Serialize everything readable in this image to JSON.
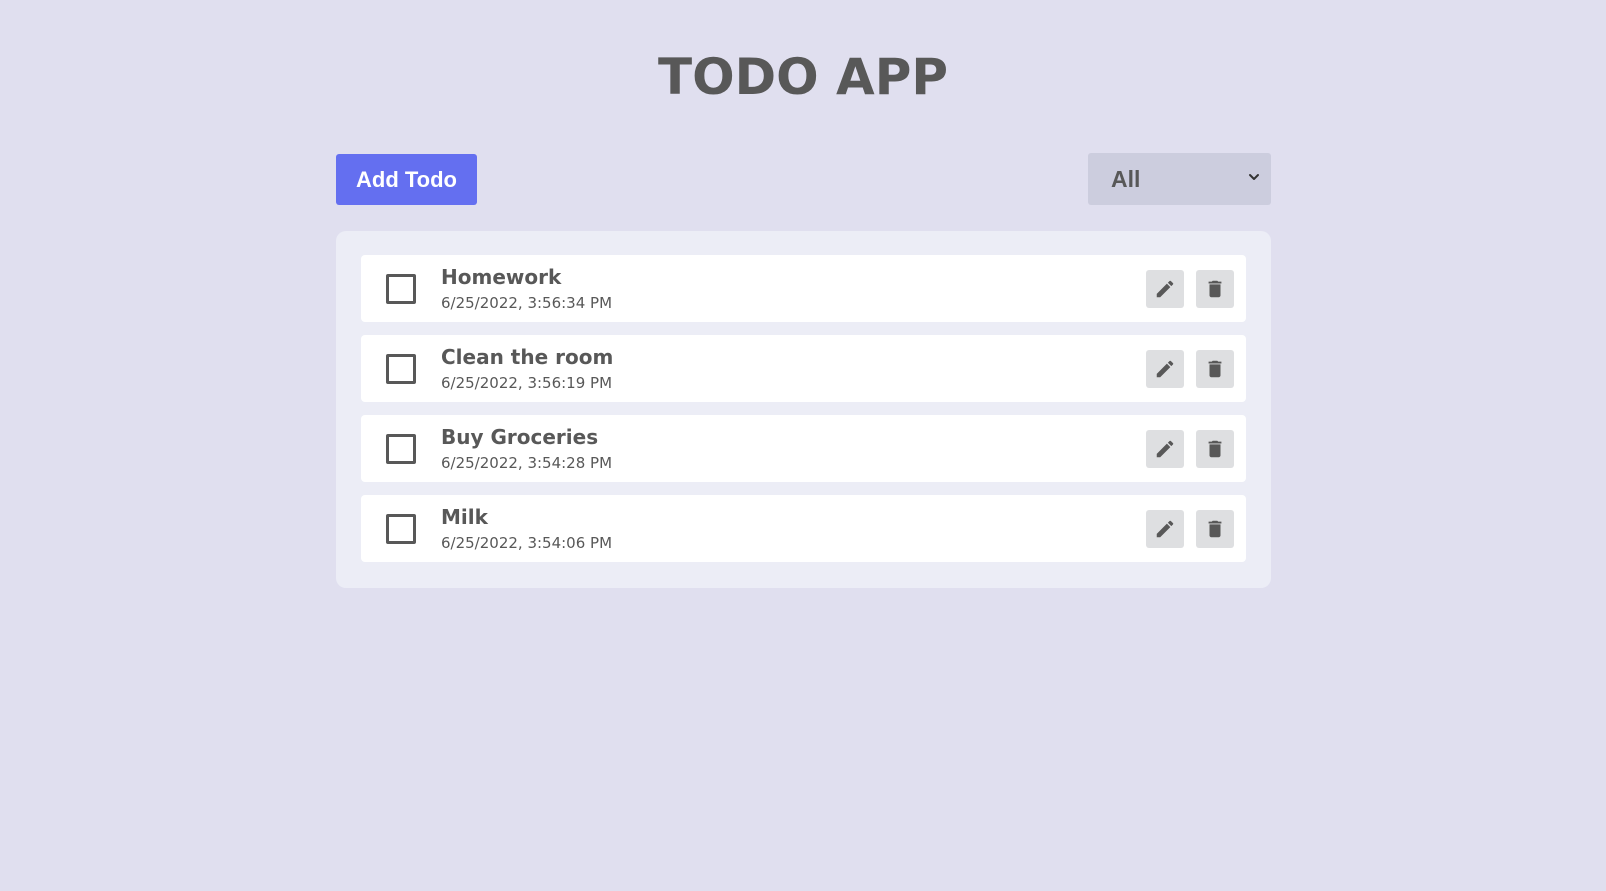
{
  "app": {
    "title": "TODO APP"
  },
  "toolbar": {
    "add_label": "Add Todo",
    "filter": {
      "selected": "All",
      "icon": "chevron-down-icon"
    }
  },
  "todos": [
    {
      "title": "Homework",
      "time": "6/25/2022, 3:56:34 PM",
      "completed": false
    },
    {
      "title": "Clean the room",
      "time": "6/25/2022, 3:56:19 PM",
      "completed": false
    },
    {
      "title": "Buy Groceries",
      "time": "6/25/2022, 3:54:28 PM",
      "completed": false
    },
    {
      "title": "Milk",
      "time": "6/25/2022, 3:54:06 PM",
      "completed": false
    }
  ],
  "icons": {
    "edit": "pencil-icon",
    "delete": "trash-icon"
  },
  "colors": {
    "background": "#e0dfef",
    "panel": "#ecedf6",
    "accent": "#646ff0",
    "text": "#585858",
    "select_bg": "#cccdde",
    "icon_button_bg": "#dedfe1"
  }
}
